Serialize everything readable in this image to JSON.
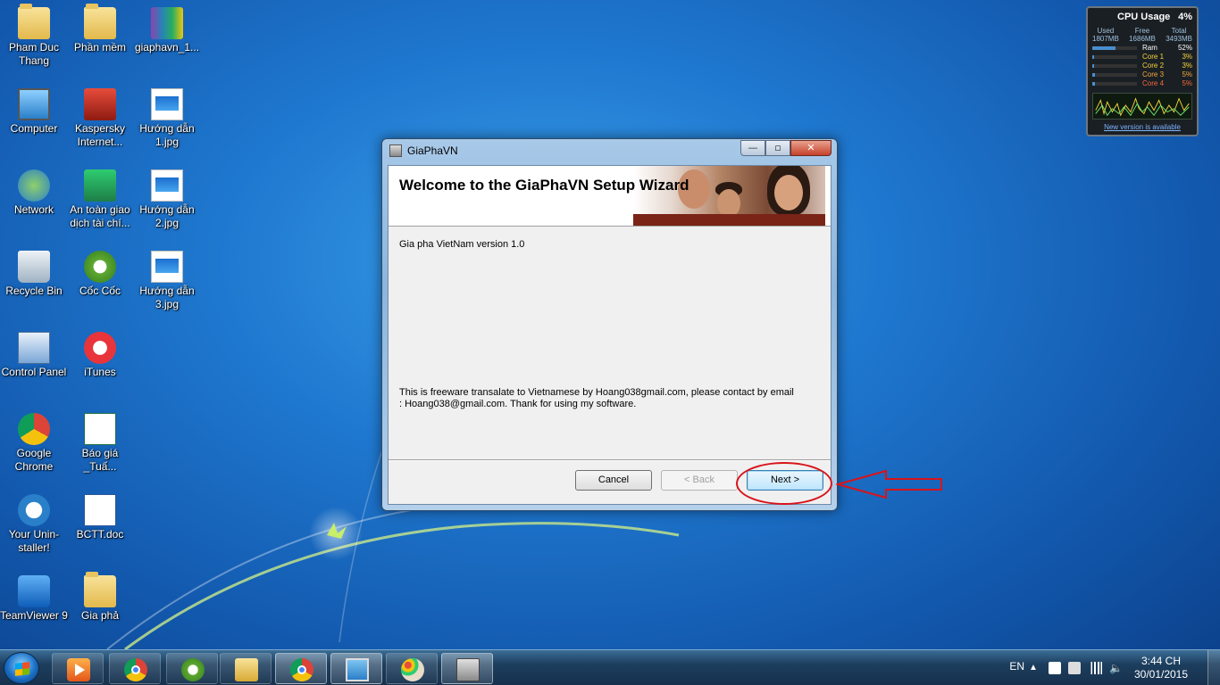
{
  "desktop": {
    "icons": [
      {
        "label": "Pham Duc Thang"
      },
      {
        "label": "Phần mềm"
      },
      {
        "label": "giaphavn_1..."
      },
      {
        "label": "Computer"
      },
      {
        "label": "Kaspersky Internet..."
      },
      {
        "label": "Hướng dẫn 1.jpg"
      },
      {
        "label": "Network"
      },
      {
        "label": "An toàn giao dịch tài chí..."
      },
      {
        "label": "Hướng dẫn 2.jpg"
      },
      {
        "label": "Recycle Bin"
      },
      {
        "label": "Cốc Cốc"
      },
      {
        "label": "Hướng dẫn 3.jpg"
      },
      {
        "label": "Control Panel"
      },
      {
        "label": "iTunes"
      },
      {
        "label": "Google Chrome"
      },
      {
        "label": "Báo giá _Tuấ..."
      },
      {
        "label": "Your Unin-staller!"
      },
      {
        "label": "BCTT.doc"
      },
      {
        "label": "TeamViewer 9"
      },
      {
        "label": "Gia phả"
      }
    ]
  },
  "gadget": {
    "title": "CPU Usage",
    "cpu": "4%",
    "headers": [
      "Used",
      "Free",
      "Total"
    ],
    "mem": [
      "1807MB",
      "1686MB",
      "3493MB"
    ],
    "rows": [
      {
        "label": "Ram",
        "value": "52%",
        "level": 0.52,
        "color": "#ffffff"
      },
      {
        "label": "Core 1",
        "value": "3%",
        "level": 0.03,
        "color": "#f5d33a"
      },
      {
        "label": "Core 2",
        "value": "3%",
        "level": 0.03,
        "color": "#f5d33a"
      },
      {
        "label": "Core 3",
        "value": "5%",
        "level": 0.05,
        "color": "#f5a83a"
      },
      {
        "label": "Core 4",
        "value": "5%",
        "level": 0.05,
        "color": "#f56a3a"
      }
    ],
    "link": "New version is available"
  },
  "dialog": {
    "title": "GiaPhaVN",
    "heading": "Welcome to the GiaPhaVN Setup Wizard",
    "version_text": "Gia pha VietNam version 1.0",
    "description": "This is freeware transalate to Vietnamese by Hoang038gmail.com, please contact by email : Hoang038@gmail.com. Thank for using my software.",
    "buttons": {
      "cancel": "Cancel",
      "back": "< Back",
      "next": "Next >"
    },
    "window_controls": {
      "minimize": "—",
      "maximize": "▫",
      "close": "✕"
    }
  },
  "annotation_color": "#d8141a",
  "taskbar": {
    "items": [
      "start-button",
      "media-player",
      "google-chrome",
      "coc-coc",
      "windows-explorer",
      "chrome-window",
      "image-viewer",
      "paint",
      "setup-installer"
    ],
    "lang": "EN",
    "time": "3:44 CH",
    "date": "30/01/2015"
  }
}
